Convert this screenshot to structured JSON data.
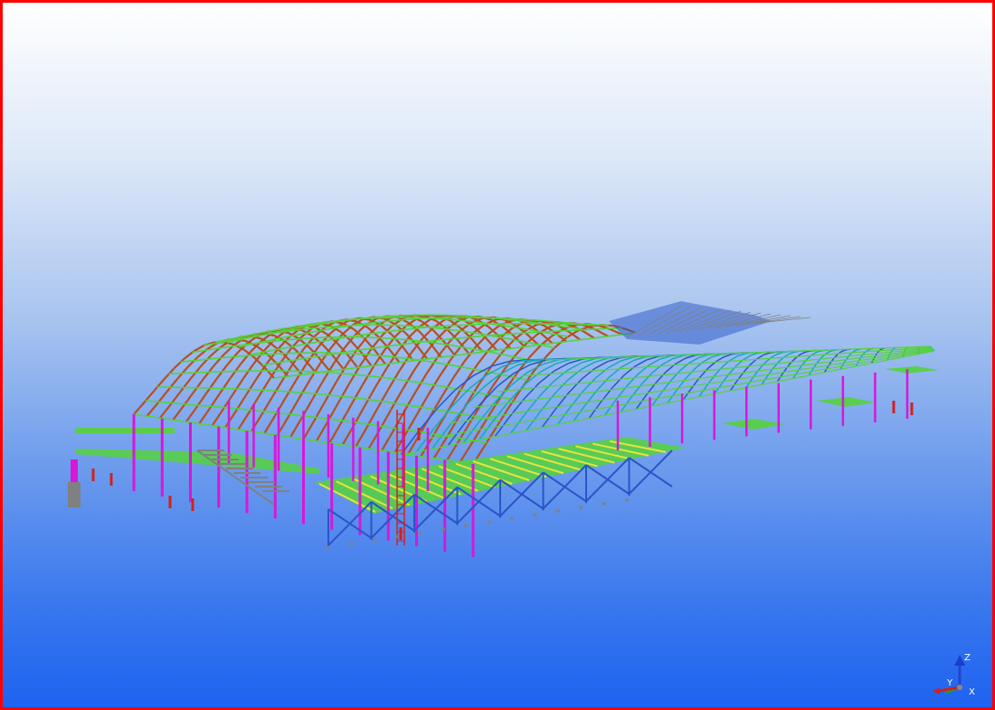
{
  "viewport": {
    "border_color": "#ff0000",
    "background_top": "#ffffff",
    "background_bottom": "#1e63f0"
  },
  "model": {
    "member_colors": {
      "roof_rafter": "#b5501f",
      "purlin": "#55d23c",
      "column": "#d817d8",
      "brace": "#2a55c8",
      "deck": "#e8e33a",
      "secondary": "#18a8b8",
      "grey": "#808080",
      "red": "#d42020"
    }
  },
  "axis_triad": {
    "x_label": "X",
    "y_label": "Y",
    "z_label": "Z",
    "z_icon": "z-axis-icon",
    "x_icon": "x-axis-icon",
    "y_icon": "y-axis-icon"
  }
}
